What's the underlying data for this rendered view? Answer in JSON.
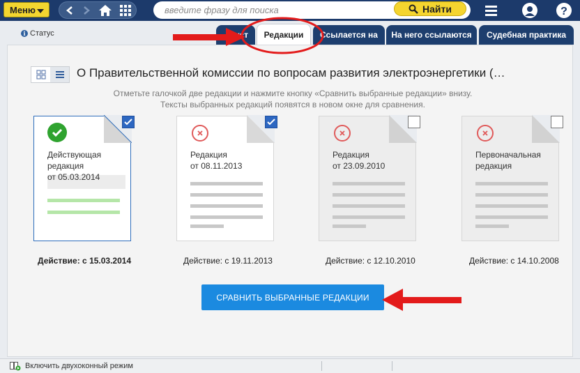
{
  "topbar": {
    "menu_label": "Меню",
    "search_placeholder": "введите фразу для поиска",
    "find_label": "Найти"
  },
  "status_label": "Статус",
  "tabs": [
    {
      "label": "Текст",
      "active": false
    },
    {
      "label": "Редакции",
      "active": true
    },
    {
      "label": "Ссылается на",
      "active": false
    },
    {
      "label": "На него ссылаются",
      "active": false
    },
    {
      "label": "Судебная практика",
      "active": false
    }
  ],
  "document": {
    "title": "О Правительственной комиссии по вопросам развития электроэнергетики (…",
    "hint_line1": "Отметьте галочкой две редакции и нажмите кнопку «Сравнить выбранные редакции» внизу.",
    "hint_line2": "Тексты выбранных редакций появятся в новом окне для сравнения."
  },
  "editions": [
    {
      "title_l1": "Действующая",
      "title_l2": "редакция",
      "title_l3": "от 05.03.2014",
      "action": "Действие: с 15.03.2014",
      "checked": true,
      "current": true
    },
    {
      "title_l1": "Редакция",
      "title_l2": "от 08.11.2013",
      "title_l3": "",
      "action": "Действие: с 19.11.2013",
      "checked": true,
      "current": false
    },
    {
      "title_l1": "Редакция",
      "title_l2": "от 23.09.2010",
      "title_l3": "",
      "action": "Действие: с 12.10.2010",
      "checked": false,
      "current": false
    },
    {
      "title_l1": "Первоначальная",
      "title_l2": "редакция",
      "title_l3": "",
      "action": "Действие: с 14.10.2008",
      "checked": false,
      "current": false
    }
  ],
  "compare_label": "СРАВНИТЬ ВЫБРАННЫЕ РЕДАКЦИИ",
  "bottombar": {
    "twin_mode_label": "Включить двухоконный режим"
  },
  "colors": {
    "topbar": "#1c3a6b",
    "accent_yellow": "#f5d52f",
    "tab": "#1d3e6e",
    "compare_button": "#1b8ae0",
    "checkbox_checked": "#2d67c1",
    "annotation_red": "#e31b1b"
  }
}
